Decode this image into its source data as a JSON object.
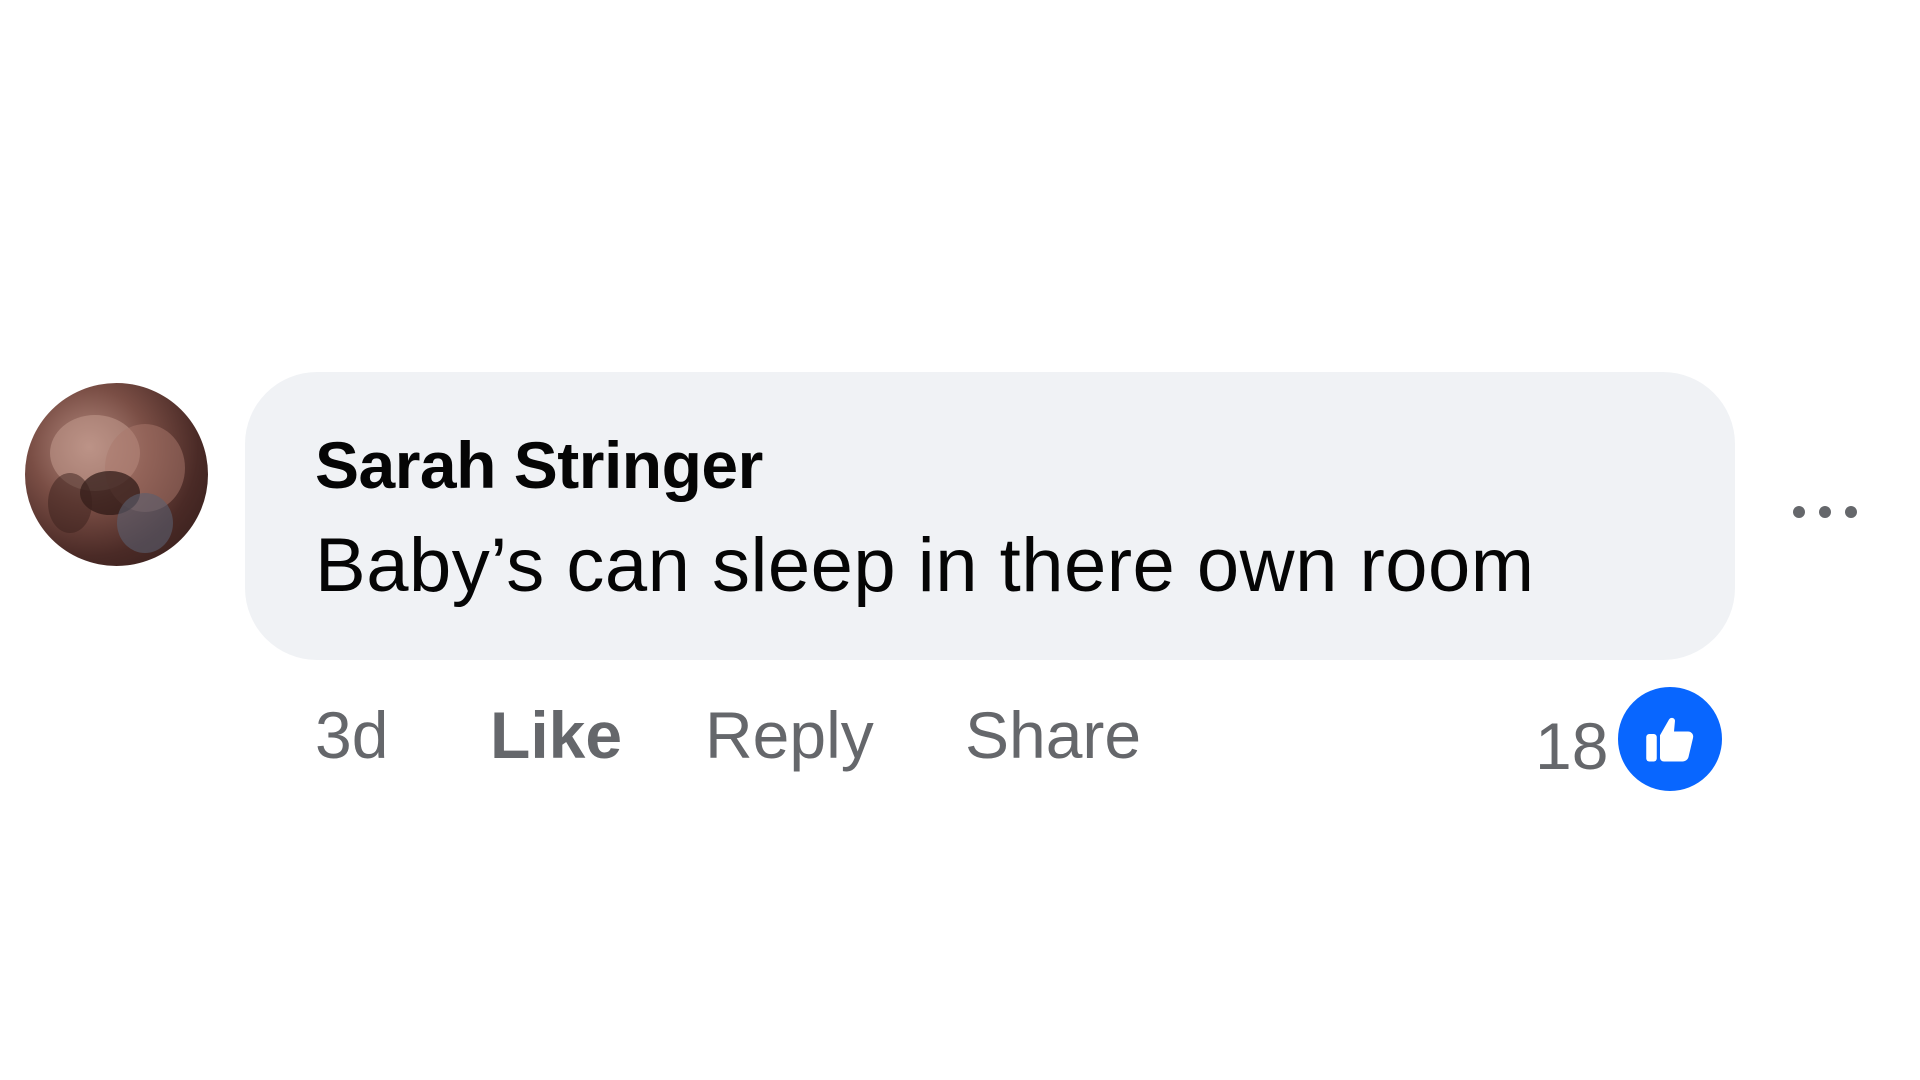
{
  "comment": {
    "author": "Sarah Stringer",
    "text": "Baby’s can sleep in there own room",
    "timestamp": "3d",
    "actions": {
      "like_label": "Like",
      "reply_label": "Reply",
      "share_label": "Share"
    },
    "reactions": {
      "count": "18",
      "type_icon": "like-icon"
    },
    "more_icon": "ellipsis-icon"
  },
  "colors": {
    "bubble_background": "#f0f2f5",
    "secondary_text": "#65676b",
    "primary_text": "#050505",
    "like_blue": "#0866ff"
  }
}
